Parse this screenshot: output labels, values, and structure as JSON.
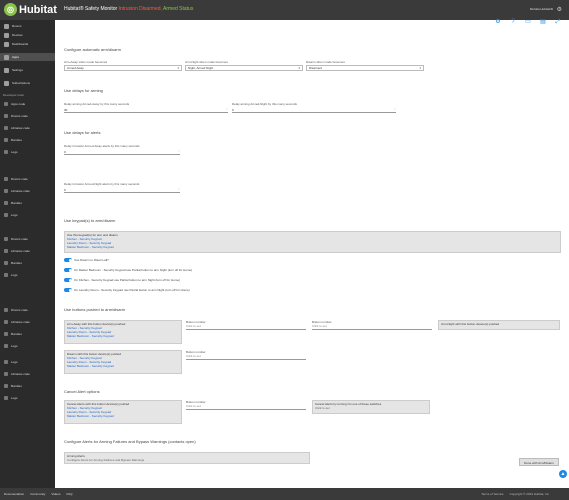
{
  "header": {
    "logo_text": "Hubitat",
    "title_prefix": "Hubitat® Safety Monitor",
    "title_status1": "Intrusion Disarmed,",
    "title_status2": "Armed Status",
    "hub_name": "Mohala Hubitat/D",
    "colors": {
      "bar": "#3a3a3a",
      "red": "#ff5a3c",
      "green": "#8bc34a",
      "accent": "#1e88e5"
    }
  },
  "toolbar": {
    "icons": [
      "gear-icon",
      "help-icon",
      "monitor-icon",
      "book-icon",
      "expand-icon"
    ]
  },
  "sidebar": {
    "items": [
      {
        "label": "Rooms",
        "icon": "rooms-icon"
      },
      {
        "label": "Devices",
        "icon": "devices-icon"
      },
      {
        "label": "Dashboards",
        "icon": "dashboards-icon"
      },
      {
        "label": "Apps",
        "icon": "apps-icon"
      },
      {
        "label": "Settings",
        "icon": "settings-icon"
      },
      {
        "label": "Subscriptions",
        "icon": "subscriptions-icon"
      }
    ],
    "dev_header": "Developer tools",
    "groups": [
      [
        "Apps code",
        "Drivers code",
        "Libraries code",
        "Bundles",
        "Logs"
      ],
      [
        "Drivers code",
        "Libraries code",
        "Bundles",
        "Logs"
      ],
      [
        "Drivers code",
        "Libraries code",
        "Bundles",
        "Logs"
      ],
      [
        "Drivers code",
        "Libraries code",
        "Bundles",
        "Logs"
      ],
      [
        "Logs",
        "Libraries code",
        "Bundles",
        "Logs"
      ]
    ]
  },
  "section1": {
    "title": "Configure automatic arm/disarm",
    "away_label": "Arm-Away when mode becomes",
    "away_value": "Armed Away",
    "night_label": "Arm-Night when mode becomes",
    "night_value": "Night, Armed Night",
    "disarm_label": "Disarm when mode becomes",
    "disarm_value": "Disarmed"
  },
  "section2": {
    "title": "Use delays for arming",
    "away_delay_label": "Delay arming Armed-Away by this many seconds",
    "away_delay_value": "30",
    "night_delay_label": "Delay arming Armed-Night by this many seconds",
    "night_delay_value": "0"
  },
  "section3": {
    "title": "Use delays for alerts",
    "away_label": "Delay Intrusion Armed-Away alerts by this many seconds",
    "away_value": "0",
    "night_label": "Delay Intrusion Armed-Night alerts by this many seconds",
    "night_value": "0"
  },
  "section4": {
    "title": "Use keypad(s) to arm/disarm",
    "box_header": "Use this keypad(s) for arm and disarm",
    "keypads": [
      "Kitchen - Security Keypad",
      "Laundry Room - Security Keypad",
      "Master Bedroom - Security Keypad"
    ],
    "toggles": [
      "Use Disarm to Disarm all?",
      "On Master Bedroom - Security Keypad use Partial button to arm Night (turn off for Home)",
      "On Kitchen - Security Keypad use Partial button to arm Night (turn off for Home)",
      "On Laundry Room - Security Keypad use Partial button to arm Night (turn off for Home)"
    ]
  },
  "section5": {
    "title": "Use buttons pushed to arm/disarm",
    "arm_away_header": "Arm-Away with this button device(s) pushed",
    "arm_away_devices": [
      "Kitchen - Security Keypad",
      "Laundry Room - Security Keypad",
      "Master Bedroom - Security Keypad"
    ],
    "button_number_label": "Button number",
    "click_to_set": "Click to set",
    "arm_night_header": "Arm-Night with this button device(s) pushed",
    "disarm_header": "Disarm with this button device(s) pushed",
    "disarm_devices": [
      "Kitchen - Security Keypad",
      "Laundry Room - Security Keypad",
      "Master Bedroom - Security Keypad"
    ]
  },
  "section6": {
    "title": "Cancel Alert options",
    "cancel_header": "Cancel Alerts with this button device(s) pushed",
    "cancel_devices": [
      "Kitchen - Security Keypad",
      "Laundry Room - Security Keypad",
      "Master Bedroom - Security Keypad"
    ],
    "switch_header": "Cancel Alerts by turning On one of these switches",
    "switch_value": "Click to set"
  },
  "section7": {
    "title": "Configure Alerts for Arming Failures and Bypass Warnings (contacts open)",
    "box_header": "Arming Alerts",
    "box_sub": "Configure Alerts for Arming Failures and Bypass Warnings"
  },
  "done_label": "Done with Arm/Disarm",
  "footer": {
    "left": [
      "Documentation",
      "Community",
      "Videos",
      "FAQ"
    ],
    "right": [
      "Terms of Service",
      "Copyright © 2023 Hubitat, Inc"
    ]
  }
}
